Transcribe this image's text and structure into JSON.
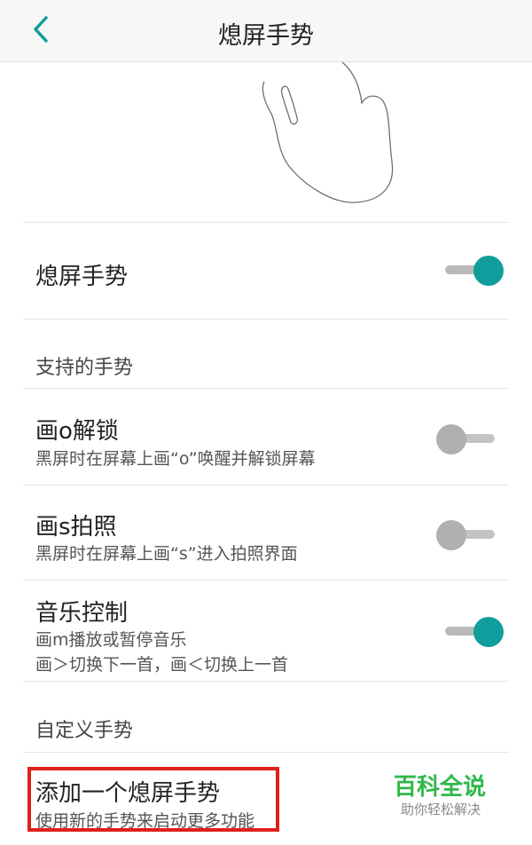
{
  "header": {
    "title": "熄屏手势",
    "back_icon": "chevron-left-icon",
    "accent": "#0f9e9b"
  },
  "main_toggle": {
    "label": "熄屏手势",
    "enabled": true
  },
  "supported": {
    "section_title": "支持的手势",
    "items": [
      {
        "title": "画o解锁",
        "desc": "黑屏时在屏幕上画“o”唤醒并解锁屏幕",
        "enabled": false
      },
      {
        "title": "画s拍照",
        "desc": "黑屏时在屏幕上画“s”进入拍照界面",
        "enabled": false
      },
      {
        "title": "音乐控制",
        "desc": "画m播放或暂停音乐",
        "desc2": "画＞切换下一首，画＜切换上一首",
        "enabled": true
      }
    ]
  },
  "custom": {
    "section_title": "自定义手势",
    "add_title": "添加一个熄屏手势",
    "add_desc": "使用新的手势来启动更多功能"
  },
  "watermark": {
    "line1": "百科全说",
    "line2": "助你轻松解决",
    "color": "#2fb84a"
  }
}
